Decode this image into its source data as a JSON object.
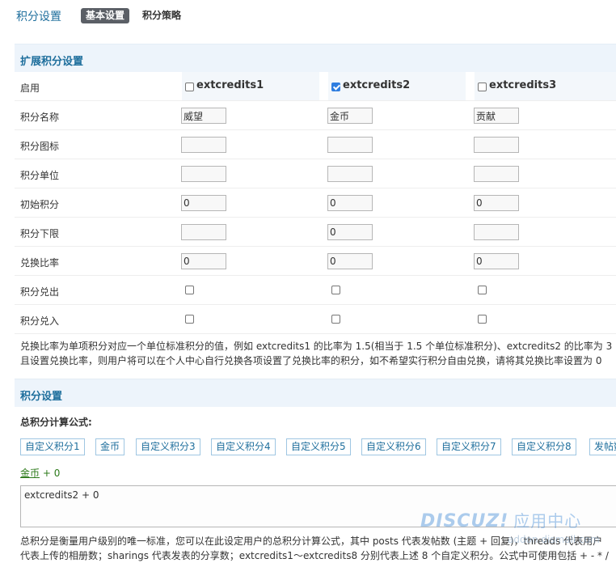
{
  "header": {
    "title": "积分设置",
    "tabs": [
      {
        "label": "基本设置",
        "active": true
      },
      {
        "label": "积分策略",
        "active": false
      }
    ]
  },
  "extended": {
    "title": "扩展积分设置",
    "columns": [
      {
        "name": "extcredits1",
        "enabled": false
      },
      {
        "name": "extcredits2",
        "enabled": true
      },
      {
        "name": "extcredits3",
        "enabled": false
      }
    ],
    "rows": {
      "enable_label": "启用",
      "name": {
        "label": "积分名称",
        "values": [
          "威望",
          "金币",
          "贡献"
        ]
      },
      "icon": {
        "label": "积分图标",
        "values": [
          "",
          "",
          ""
        ]
      },
      "unit": {
        "label": "积分单位",
        "values": [
          "",
          "",
          ""
        ]
      },
      "initial": {
        "label": "初始积分",
        "values": [
          "0",
          "0",
          "0"
        ]
      },
      "lower": {
        "label": "积分下限",
        "values": [
          "",
          "0",
          ""
        ]
      },
      "ratio": {
        "label": "兑换比率",
        "values": [
          "0",
          "0",
          "0"
        ]
      },
      "out": {
        "label": "积分兑出",
        "values": [
          false,
          false,
          false
        ]
      },
      "in": {
        "label": "积分兑入",
        "values": [
          false,
          false,
          false
        ]
      }
    },
    "note_line1": "兑换比率为单项积分对应一个单位标准积分的值，例如 extcredits1 的比率为 1.5(相当于 1.5 个单位标准积分)、extcredits2 的比率为 3",
    "note_line2": "且设置兑换比率，则用户将可以在个人中心自行兑换各项设置了兑换比率的积分，如不希望实行积分自由兑换，请将其兑换比率设置为 0"
  },
  "credit": {
    "title": "积分设置",
    "formula_title": "总积分计算公式:",
    "buttons": [
      "自定义积分1",
      "金币",
      "自定义积分3",
      "自定义积分4",
      "自定义积分5",
      "自定义积分6",
      "自定义积分7",
      "自定义积分8",
      "发帖数"
    ],
    "expr_var": "金币",
    "expr_op": "+ 0",
    "formula_value": "extcredits2 + 0",
    "note_line1": "总积分是衡量用户级别的唯一标准，您可以在此设定用户的总积分计算公式，其中 posts 代表发帖数 (主题 + 回复)，threads 代表用户",
    "note_line2": "代表上传的相册数；sharings 代表发表的分享数；extcredits1～extcredits8 分别代表上述 8 个自定义积分。公式中可使用包括 + - * /"
  },
  "watermark": {
    "brand": "DISCUZ!",
    "cn": "应用中心",
    "sub": "addon.dismall.com"
  },
  "colors": {
    "accent": "#1f6f9d",
    "header_bg": "#edf4fb",
    "tab_bg": "#5b5f66",
    "formula_var": "#2c7a1a"
  }
}
